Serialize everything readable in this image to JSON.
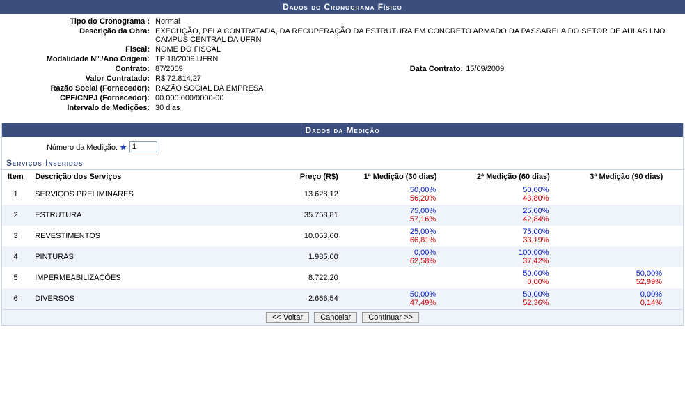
{
  "header1": "Dados do Cronograma Físico",
  "info": {
    "tipo_label": "Tipo do Cronograma :",
    "tipo": "Normal",
    "descricao_label": "Descrição da Obra:",
    "descricao": "EXECUÇÃO, PELA CONTRATADA, DA RECUPERAÇÃO DA ESTRUTURA EM CONCRETO ARMADO DA PASSARELA DO SETOR DE AULAS I NO CAMPUS CENTRAL DA UFRN",
    "fiscal_label": "Fiscal:",
    "fiscal": "NOME DO FISCAL",
    "modalidade_label": "Modalidade Nº./Ano Origem:",
    "modalidade": "TP 18/2009 UFRN",
    "contrato_label": "Contrato:",
    "contrato": "87/2009",
    "data_contrato_label": "Data Contrato:",
    "data_contrato": "15/09/2009",
    "valor_label": "Valor Contratado:",
    "valor": "R$ 72.814,27",
    "razao_label": "Razão Social (Fornecedor):",
    "razao": "RAZÃO SOCIAL DA EMPRESA",
    "cnpj_label": "CPF/CNPJ (Fornecedor):",
    "cnpj": "00.000.000/0000-00",
    "intervalo_label": "Intervalo de Medições:",
    "intervalo": "30 dias"
  },
  "header2": "Dados da Medição",
  "medicao": {
    "numero_label": "Número da Medição:",
    "numero_value": "1"
  },
  "section_servicos": "Serviços Inseridos",
  "table": {
    "headers": {
      "item": "Item",
      "desc": "Descrição dos Serviços",
      "preco": "Preço (R$)",
      "m1": "1ª Medição (30 dias)",
      "m2": "2ª Medição (60 dias)",
      "m3": "3ª Medição (90 dias)"
    },
    "rows": [
      {
        "item": "1",
        "desc": "SERVIÇOS PRELIMINARES",
        "preco": "13.628,12",
        "m1b": "50,00%",
        "m1r": "56,20%",
        "m2b": "50,00%",
        "m2r": "43,80%",
        "m3b": "",
        "m3r": ""
      },
      {
        "item": "2",
        "desc": "ESTRUTURA",
        "preco": "35.758,81",
        "m1b": "75,00%",
        "m1r": "57,16%",
        "m2b": "25,00%",
        "m2r": "42,84%",
        "m3b": "",
        "m3r": ""
      },
      {
        "item": "3",
        "desc": "REVESTIMENTOS",
        "preco": "10.053,60",
        "m1b": "25,00%",
        "m1r": "66,81%",
        "m2b": "75,00%",
        "m2r": "33,19%",
        "m3b": "",
        "m3r": ""
      },
      {
        "item": "4",
        "desc": "PINTURAS",
        "preco": "1.985,00",
        "m1b": "0,00%",
        "m1r": "62,58%",
        "m2b": "100,00%",
        "m2r": "37,42%",
        "m3b": "",
        "m3r": ""
      },
      {
        "item": "5",
        "desc": "IMPERMEABILIZAÇÕES",
        "preco": "8.722,20",
        "m1b": "",
        "m1r": "",
        "m2b": "50,00%",
        "m2r": "0,00%",
        "m3b": "50,00%",
        "m3r": "52,99%"
      },
      {
        "item": "6",
        "desc": "DIVERSOS",
        "preco": "2.666,54",
        "m1b": "50,00%",
        "m1r": "47,49%",
        "m2b": "50,00%",
        "m2r": "52,36%",
        "m3b": "0,00%",
        "m3r": "0,14%"
      }
    ]
  },
  "buttons": {
    "voltar": "<< Voltar",
    "cancelar": "Cancelar",
    "continuar": "Continuar >>"
  }
}
